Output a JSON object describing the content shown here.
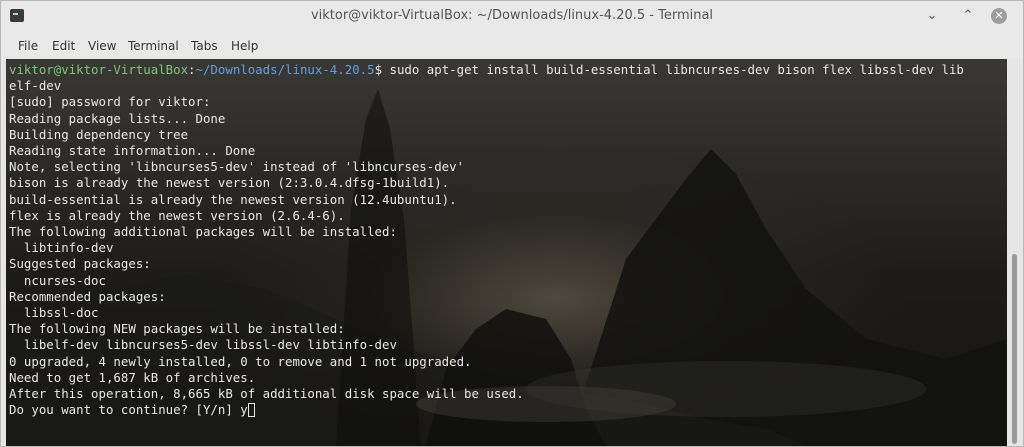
{
  "window": {
    "title": "viktor@viktor-VirtualBox: ~/Downloads/linux-4.20.5 - Terminal",
    "minimize_glyph": "⌄",
    "maximize_glyph": "⌃",
    "close_glyph": "✕"
  },
  "menu": [
    "File",
    "Edit",
    "View",
    "Terminal",
    "Tabs",
    "Help"
  ],
  "terminal": {
    "prompt_user": "viktor@viktor-VirtualBox",
    "prompt_sep": ":",
    "prompt_path": "~/Downloads/linux-4.20.5",
    "prompt_symbol": "$",
    "command": " sudo apt-get install build-essential libncurses-dev bison flex libssl-dev lib",
    "lines": [
      "elf-dev",
      "[sudo] password for viktor:",
      "Reading package lists... Done",
      "Building dependency tree",
      "Reading state information... Done",
      "Note, selecting 'libncurses5-dev' instead of 'libncurses-dev'",
      "bison is already the newest version (2:3.0.4.dfsg-1build1).",
      "build-essential is already the newest version (12.4ubuntu1).",
      "flex is already the newest version (2.6.4-6).",
      "The following additional packages will be installed:",
      "  libtinfo-dev",
      "Suggested packages:",
      "  ncurses-doc",
      "Recommended packages:",
      "  libssl-doc",
      "The following NEW packages will be installed:",
      "  libelf-dev libncurses5-dev libssl-dev libtinfo-dev",
      "0 upgraded, 4 newly installed, 0 to remove and 1 not upgraded.",
      "Need to get 1,687 kB of archives.",
      "After this operation, 8,665 kB of additional disk space will be used."
    ],
    "last_line": "Do you want to continue? [Y/n] y"
  },
  "colors": {
    "prompt_user": "#78c878",
    "prompt_path": "#5f9ee0",
    "text": "#e8e8e8"
  },
  "icons": [
    "terminal-app-icon",
    "minimize-icon",
    "maximize-icon",
    "close-icon",
    "cursor-block"
  ]
}
